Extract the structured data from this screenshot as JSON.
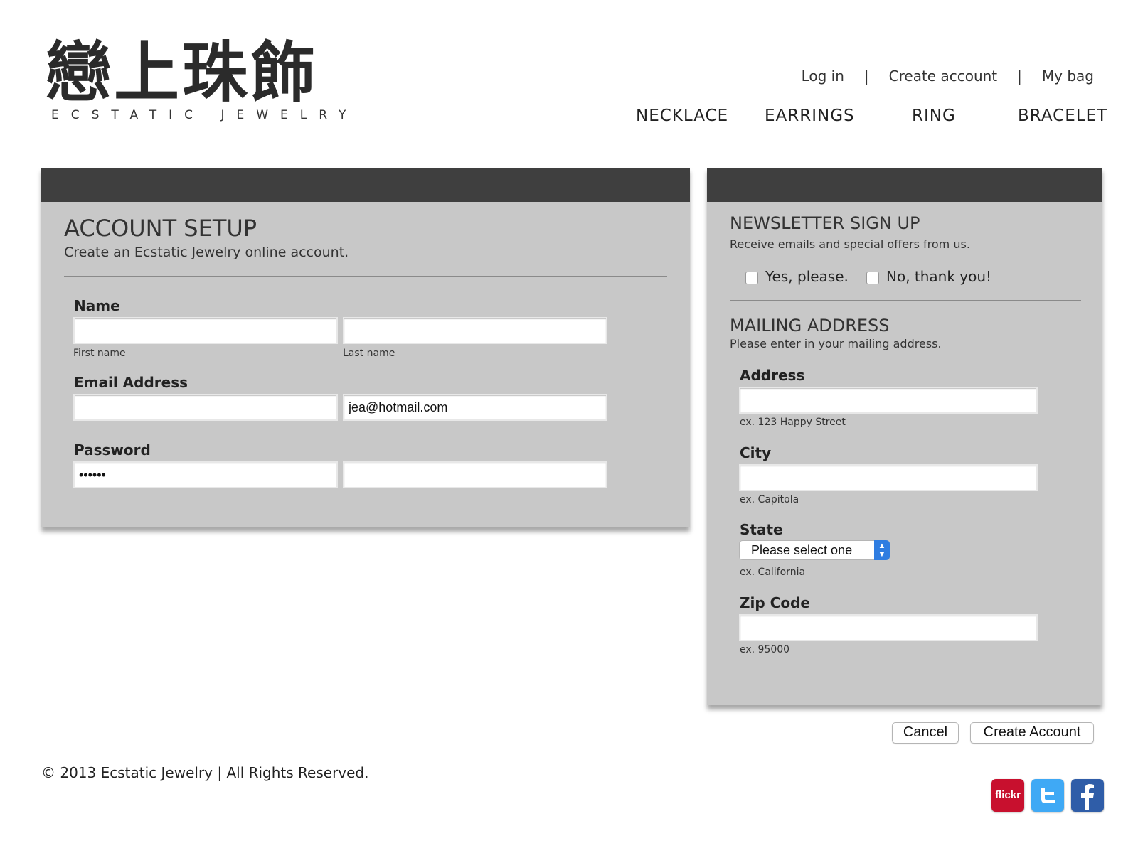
{
  "brand": {
    "logo_cjk": "戀上珠飾",
    "logo_en": "ECSTATIC JEWELRY"
  },
  "top_links": {
    "login": "Log in",
    "separator": "|",
    "create_account": "Create account",
    "my_bag": "My bag"
  },
  "nav": {
    "necklace": "NECKLACE",
    "earrings": "EARRINGS",
    "ring": "RING",
    "bracelet": "BRACELET"
  },
  "account": {
    "title": "ACCOUNT SETUP",
    "subtitle": "Create an Ecstatic Jewelry online account.",
    "name_label": "Name",
    "first_name_value": "",
    "first_name_hint": "First name",
    "last_name_value": "",
    "last_name_hint": "Last name",
    "email_label": "Email Address",
    "email_value": "",
    "email_confirm_value": "jea@hotmail.com",
    "password_label": "Password",
    "password_value": "••••••",
    "password_confirm_value": ""
  },
  "newsletter": {
    "title": "NEWSLETTER SIGN UP",
    "subtitle": "Receive emails and special offers from us.",
    "option_yes": "Yes, please.",
    "option_no": "No, thank you!",
    "yes_checked": false,
    "no_checked": false
  },
  "mailing": {
    "title": "MAILING ADDRESS",
    "subtitle": "Please enter in your mailing address.",
    "address_label": "Address",
    "address_value": "",
    "address_hint": "ex. 123 Happy Street",
    "city_label": "City",
    "city_value": "",
    "city_hint": "ex. Capitola",
    "state_label": "State",
    "state_selected": "Please select one",
    "state_hint": "ex. California",
    "zip_label": "Zip Code",
    "zip_value": "",
    "zip_hint": "ex. 95000"
  },
  "actions": {
    "cancel": "Cancel",
    "create_account": "Create Account"
  },
  "footer": {
    "copyright": "© 2013 Ecstatic Jewelry | All Rights Reserved."
  },
  "social": {
    "flickr": "flickr",
    "twitter_icon": "twitter-icon",
    "facebook_icon": "facebook-icon",
    "flickr_color": "#c8102e",
    "twitter_color": "#3fa9f5",
    "facebook_color": "#2f5da8"
  },
  "colors": {
    "panel_bg": "#c8c8c8",
    "panel_bar": "#3f3f3f",
    "select_accent": "#2f7de1"
  }
}
